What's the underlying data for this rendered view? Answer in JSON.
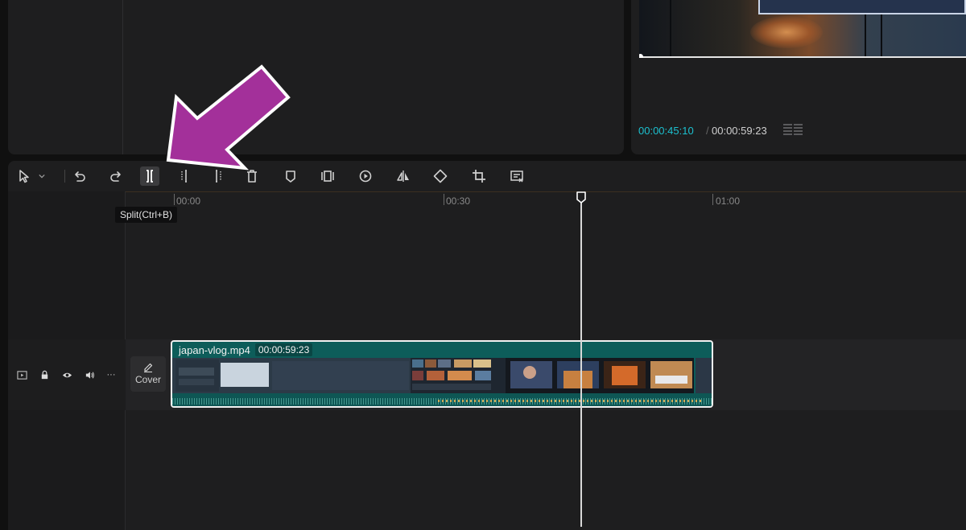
{
  "preview": {
    "current_time": "00:00:45:10",
    "separator": "/",
    "total_time": "00:00:59:23"
  },
  "toolbar": {
    "tools": [
      {
        "name": "select-tool",
        "icon": "pointer-icon"
      },
      {
        "name": "select-dropdown",
        "icon": "chevron-down-icon"
      },
      {
        "name": "undo",
        "icon": "undo-icon"
      },
      {
        "name": "redo",
        "icon": "redo-icon"
      },
      {
        "name": "split",
        "icon": "split-icon"
      },
      {
        "name": "trim-left",
        "icon": "trim-left-icon"
      },
      {
        "name": "trim-right",
        "icon": "trim-right-icon"
      },
      {
        "name": "delete",
        "icon": "trash-icon"
      },
      {
        "name": "marker",
        "icon": "marker-icon"
      },
      {
        "name": "freeze",
        "icon": "freeze-icon"
      },
      {
        "name": "reverse",
        "icon": "reverse-icon"
      },
      {
        "name": "mirror",
        "icon": "mirror-icon"
      },
      {
        "name": "rotate",
        "icon": "rotate-icon"
      },
      {
        "name": "crop",
        "icon": "crop-icon"
      },
      {
        "name": "more-edit",
        "icon": "edit-list-icon"
      }
    ],
    "tooltip": "Split(Ctrl+B)"
  },
  "ruler": {
    "labels": [
      "00:00",
      "00:30",
      "01:00"
    ]
  },
  "track": {
    "controls": [
      "video-track-icon",
      "lock-icon",
      "eye-icon",
      "volume-icon",
      "more-icon"
    ],
    "more_label": "···",
    "cover_label": "Cover"
  },
  "clip": {
    "name": "japan-vlog.mp4",
    "duration": "00:00:59:23"
  },
  "playhead": {
    "time": "00:00:45:10"
  },
  "colors": {
    "accent_timecode": "#1cc0cf",
    "clip_fill": "#0d5d5a",
    "annotation_arrow": "#a3309a"
  }
}
